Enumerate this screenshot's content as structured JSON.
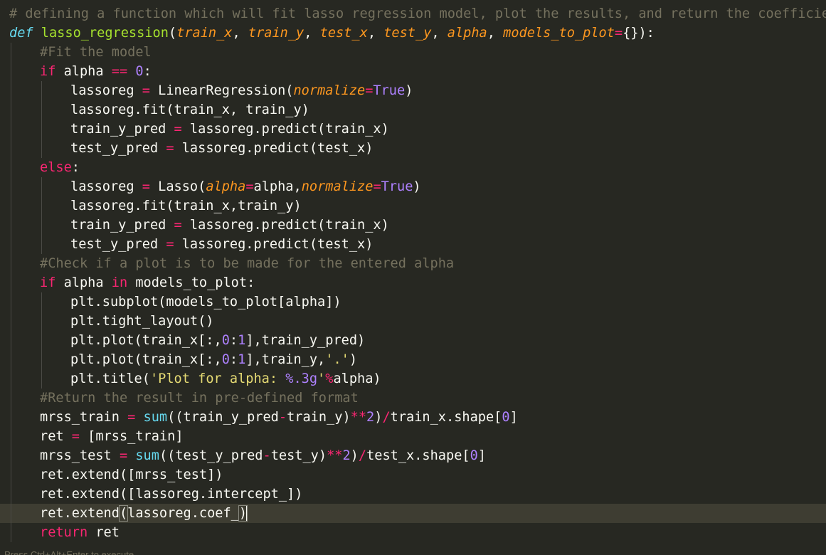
{
  "editor": {
    "theme_colors": {
      "background": "#272822",
      "foreground": "#f8f8f2",
      "comment": "#75715e",
      "keyword": "#f92672",
      "function_name": "#a6e22e",
      "parameter": "#fd971f",
      "number": "#ae81ff",
      "builtin": "#66d9ef",
      "string": "#e6db74",
      "current_line": "#3e3d32"
    },
    "current_line_index": 26,
    "lines": [
      {
        "indent": 0,
        "tokens": [
          [
            "comment",
            "# defining a function which will fit lasso regression model, plot the results, and return the coefficients"
          ]
        ]
      },
      {
        "indent": 0,
        "tokens": [
          [
            "keyword-italic",
            "def"
          ],
          [
            "plain",
            " "
          ],
          [
            "funcname",
            "lasso_regression"
          ],
          [
            "plain",
            "("
          ],
          [
            "param",
            "train_x"
          ],
          [
            "plain",
            ", "
          ],
          [
            "param",
            "train_y"
          ],
          [
            "plain",
            ", "
          ],
          [
            "param",
            "test_x"
          ],
          [
            "plain",
            ", "
          ],
          [
            "param",
            "test_y"
          ],
          [
            "plain",
            ", "
          ],
          [
            "param",
            "alpha"
          ],
          [
            "plain",
            ", "
          ],
          [
            "param",
            "models_to_plot"
          ],
          [
            "operator",
            "="
          ],
          [
            "plain",
            "{}):"
          ]
        ]
      },
      {
        "indent": 1,
        "tokens": [
          [
            "comment",
            "#Fit the model"
          ]
        ]
      },
      {
        "indent": 1,
        "tokens": [
          [
            "keyword",
            "if"
          ],
          [
            "plain",
            " alpha "
          ],
          [
            "operator",
            "=="
          ],
          [
            "plain",
            " "
          ],
          [
            "number",
            "0"
          ],
          [
            "plain",
            ":"
          ]
        ]
      },
      {
        "indent": 2,
        "tokens": [
          [
            "plain",
            "lassoreg "
          ],
          [
            "operator",
            "="
          ],
          [
            "plain",
            " LinearRegression("
          ],
          [
            "kwarg",
            "normalize"
          ],
          [
            "operator",
            "="
          ],
          [
            "const",
            "True"
          ],
          [
            "plain",
            ")"
          ]
        ]
      },
      {
        "indent": 2,
        "tokens": [
          [
            "plain",
            "lassoreg.fit(train_x, train_y)"
          ]
        ]
      },
      {
        "indent": 2,
        "tokens": [
          [
            "plain",
            "train_y_pred "
          ],
          [
            "operator",
            "="
          ],
          [
            "plain",
            " lassoreg.predict(train_x)"
          ]
        ]
      },
      {
        "indent": 2,
        "tokens": [
          [
            "plain",
            "test_y_pred "
          ],
          [
            "operator",
            "="
          ],
          [
            "plain",
            " lassoreg.predict(test_x)"
          ]
        ]
      },
      {
        "indent": 1,
        "tokens": [
          [
            "keyword",
            "else"
          ],
          [
            "plain",
            ":"
          ]
        ]
      },
      {
        "indent": 2,
        "tokens": [
          [
            "plain",
            "lassoreg "
          ],
          [
            "operator",
            "="
          ],
          [
            "plain",
            " Lasso("
          ],
          [
            "kwarg",
            "alpha"
          ],
          [
            "operator",
            "="
          ],
          [
            "plain",
            "alpha,"
          ],
          [
            "kwarg",
            "normalize"
          ],
          [
            "operator",
            "="
          ],
          [
            "const",
            "True"
          ],
          [
            "plain",
            ")"
          ]
        ]
      },
      {
        "indent": 2,
        "tokens": [
          [
            "plain",
            "lassoreg.fit(train_x,train_y)"
          ]
        ]
      },
      {
        "indent": 2,
        "tokens": [
          [
            "plain",
            "train_y_pred "
          ],
          [
            "operator",
            "="
          ],
          [
            "plain",
            " lassoreg.predict(train_x)"
          ]
        ]
      },
      {
        "indent": 2,
        "tokens": [
          [
            "plain",
            "test_y_pred "
          ],
          [
            "operator",
            "="
          ],
          [
            "plain",
            " lassoreg.predict(test_x)"
          ]
        ]
      },
      {
        "indent": 1,
        "tokens": [
          [
            "comment",
            "#Check if a plot is to be made for the entered alpha"
          ]
        ]
      },
      {
        "indent": 1,
        "tokens": [
          [
            "keyword",
            "if"
          ],
          [
            "plain",
            " alpha "
          ],
          [
            "keyword",
            "in"
          ],
          [
            "plain",
            " models_to_plot:"
          ]
        ]
      },
      {
        "indent": 2,
        "tokens": [
          [
            "plain",
            "plt.subplot(models_to_plot[alpha])"
          ]
        ]
      },
      {
        "indent": 2,
        "tokens": [
          [
            "plain",
            "plt.tight_layout()"
          ]
        ]
      },
      {
        "indent": 2,
        "tokens": [
          [
            "plain",
            "plt.plot(train_x[:,"
          ],
          [
            "number",
            "0"
          ],
          [
            "plain",
            ":"
          ],
          [
            "number",
            "1"
          ],
          [
            "plain",
            "],train_y_pred)"
          ]
        ]
      },
      {
        "indent": 2,
        "tokens": [
          [
            "plain",
            "plt.plot(train_x[:,"
          ],
          [
            "number",
            "0"
          ],
          [
            "plain",
            ":"
          ],
          [
            "number",
            "1"
          ],
          [
            "plain",
            "],train_y,"
          ],
          [
            "string",
            "'.'"
          ],
          [
            "plain",
            ")"
          ]
        ]
      },
      {
        "indent": 2,
        "tokens": [
          [
            "plain",
            "plt.title("
          ],
          [
            "string",
            "'Plot for alpha: "
          ],
          [
            "number",
            "%.3g"
          ],
          [
            "string",
            "'"
          ],
          [
            "operator",
            "%"
          ],
          [
            "plain",
            "alpha)"
          ]
        ]
      },
      {
        "indent": 1,
        "tokens": [
          [
            "comment",
            "#Return the result in pre-defined format"
          ]
        ]
      },
      {
        "indent": 1,
        "tokens": [
          [
            "plain",
            "mrss_train "
          ],
          [
            "operator",
            "="
          ],
          [
            "plain",
            " "
          ],
          [
            "builtin",
            "sum"
          ],
          [
            "plain",
            "((train_y_pred"
          ],
          [
            "operator",
            "-"
          ],
          [
            "plain",
            "train_y)"
          ],
          [
            "operator",
            "**"
          ],
          [
            "number",
            "2"
          ],
          [
            "plain",
            ")"
          ],
          [
            "operator",
            "/"
          ],
          [
            "plain",
            "train_x.shape["
          ],
          [
            "number",
            "0"
          ],
          [
            "plain",
            "]"
          ]
        ]
      },
      {
        "indent": 1,
        "tokens": [
          [
            "plain",
            "ret "
          ],
          [
            "operator",
            "="
          ],
          [
            "plain",
            " [mrss_train]"
          ]
        ]
      },
      {
        "indent": 1,
        "tokens": [
          [
            "plain",
            "mrss_test "
          ],
          [
            "operator",
            "="
          ],
          [
            "plain",
            " "
          ],
          [
            "builtin",
            "sum"
          ],
          [
            "plain",
            "((test_y_pred"
          ],
          [
            "operator",
            "-"
          ],
          [
            "plain",
            "test_y)"
          ],
          [
            "operator",
            "**"
          ],
          [
            "number",
            "2"
          ],
          [
            "plain",
            ")"
          ],
          [
            "operator",
            "/"
          ],
          [
            "plain",
            "test_x.shape["
          ],
          [
            "number",
            "0"
          ],
          [
            "plain",
            "]"
          ]
        ]
      },
      {
        "indent": 1,
        "tokens": [
          [
            "plain",
            "ret.extend([mrss_test])"
          ]
        ]
      },
      {
        "indent": 1,
        "tokens": [
          [
            "plain",
            "ret.extend([lassoreg.intercept_])"
          ]
        ]
      },
      {
        "indent": 1,
        "tokens": [
          [
            "plain",
            "ret.extend"
          ],
          [
            "bracket-match",
            "("
          ],
          [
            "plain",
            "lassoreg.coef_"
          ],
          [
            "bracket-match",
            ")"
          ],
          [
            "cursor",
            ""
          ]
        ]
      },
      {
        "indent": 1,
        "tokens": [
          [
            "keyword",
            "return"
          ],
          [
            "plain",
            " ret"
          ]
        ]
      }
    ]
  },
  "statusbar": {
    "text": "Press Ctrl+Alt+Enter to execute"
  }
}
